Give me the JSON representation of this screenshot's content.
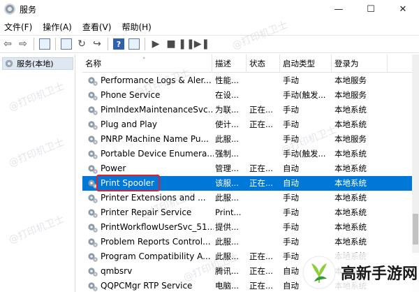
{
  "window": {
    "title": "服务",
    "controls": {
      "minimize": "—",
      "maximize": "☐",
      "close": "✕"
    }
  },
  "menu": [
    "文件(F)",
    "操作(A)",
    "查看(V)",
    "帮助(H)"
  ],
  "tree": {
    "root_label": "服务(本地)"
  },
  "columns": {
    "name": "名称",
    "desc": "描述",
    "status": "状态",
    "startup": "启动类型",
    "logon": "登录为"
  },
  "services": [
    {
      "name": "Performance Logs & Aler...",
      "desc": "性能...",
      "status": "",
      "startup": "手动",
      "logon": "本地服务"
    },
    {
      "name": "Phone Service",
      "desc": "在设...",
      "status": "",
      "startup": "手动(触发...",
      "logon": "本地服务"
    },
    {
      "name": "PimIndexMaintenanceSvc...",
      "desc": "为联...",
      "status": "正在...",
      "startup": "手动",
      "logon": "本地系统"
    },
    {
      "name": "Plug and Play",
      "desc": "使计...",
      "status": "正在...",
      "startup": "手动",
      "logon": "本地系统"
    },
    {
      "name": "PNRP Machine Name Pu...",
      "desc": "此服...",
      "status": "",
      "startup": "手动",
      "logon": "本地服务"
    },
    {
      "name": "Portable Device Enumera...",
      "desc": "强制...",
      "status": "",
      "startup": "手动(触发...",
      "logon": "本地系统"
    },
    {
      "name": "Power",
      "desc": "管理...",
      "status": "正在...",
      "startup": "自动",
      "logon": "本地系统"
    },
    {
      "name": "Print Spooler",
      "desc": "该服...",
      "status": "正在...",
      "startup": "自动",
      "logon": "本地系统"
    },
    {
      "name": "Printer Extensions and ...",
      "desc": "此服...",
      "status": "",
      "startup": "手动",
      "logon": "本地系统"
    },
    {
      "name": "Printer Repair Service",
      "desc": "Print...",
      "status": "",
      "startup": "手动",
      "logon": "本地系统"
    },
    {
      "name": "PrintWorkflowUserSvc_51...",
      "desc": "提供...",
      "status": "",
      "startup": "手动",
      "logon": "本地系统"
    },
    {
      "name": "Problem Reports Control...",
      "desc": "此服...",
      "status": "",
      "startup": "手动",
      "logon": "本地系统"
    },
    {
      "name": "Program Compatibility A...",
      "desc": "此服...",
      "status": "正在...",
      "startup": "手动",
      "logon": "本地系统"
    },
    {
      "name": "qmbsrv",
      "desc": "腾讯...",
      "status": "正在...",
      "startup": "自动",
      "logon": "本地系统"
    },
    {
      "name": "QQPCMgr RTP Service",
      "desc": "电脑...",
      "status": "正在...",
      "startup": "自动",
      "logon": "本地系统"
    }
  ],
  "selected_index": 7,
  "watermark": "@打印机卫士",
  "brand": {
    "text": "高新手游网"
  },
  "colors": {
    "selection": "#0078d7",
    "highlight_border": "#e0202a"
  }
}
